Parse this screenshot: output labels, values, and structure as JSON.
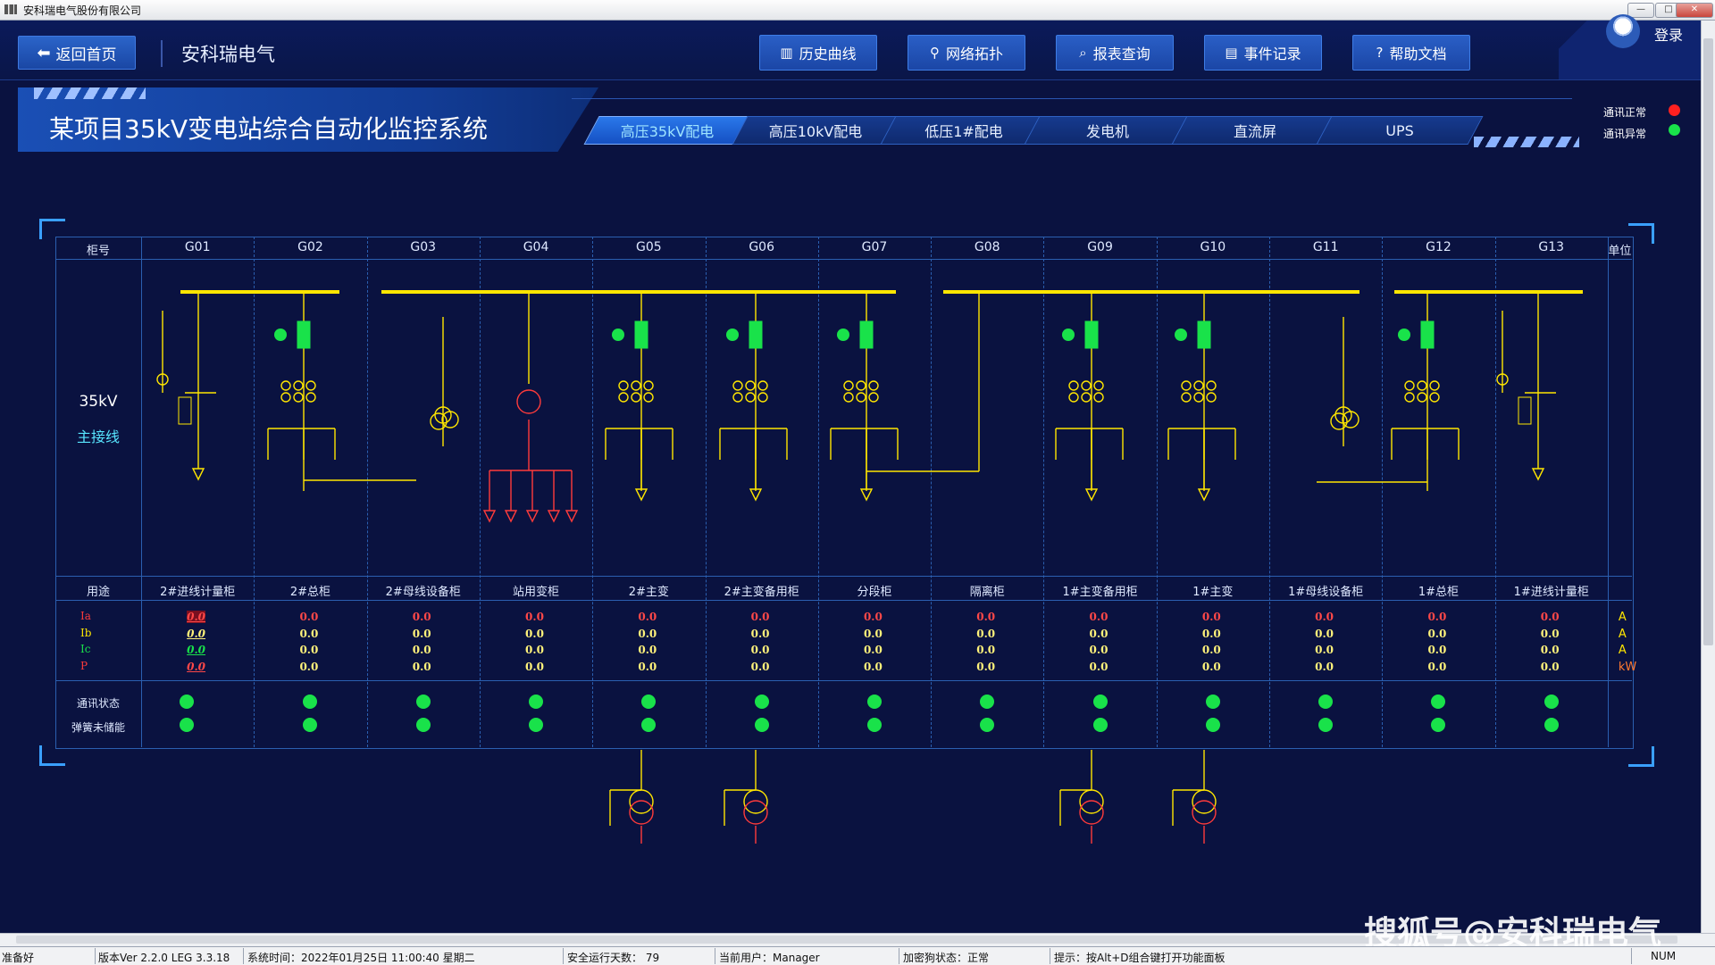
{
  "window": {
    "title": "安科瑞电气股份有限公司",
    "min": "—",
    "max": "□",
    "close": "✕"
  },
  "header": {
    "back_label": "返回首页",
    "brand": "安科瑞电气",
    "nav": [
      {
        "label": "历史曲线",
        "icon": "chart-icon"
      },
      {
        "label": "网络拓扑",
        "icon": "topology-icon"
      },
      {
        "label": "报表查询",
        "icon": "search-icon"
      },
      {
        "label": "事件记录",
        "icon": "document-icon"
      },
      {
        "label": "帮助文档",
        "icon": "help-icon"
      }
    ],
    "login_label": "登录"
  },
  "banner": {
    "title": "某项目35kV变电站综合自动化监控系统"
  },
  "tabs": [
    {
      "label": "高压35kV配电",
      "active": true
    },
    {
      "label": "高压10kV配电",
      "active": false
    },
    {
      "label": "低压1#配电",
      "active": false
    },
    {
      "label": "发电机",
      "active": false
    },
    {
      "label": "直流屏",
      "active": false
    },
    {
      "label": "UPS",
      "active": false
    }
  ],
  "comm_legend": [
    {
      "label": "通讯正常",
      "color": "#ff2020"
    },
    {
      "label": "通讯异常",
      "color": "#19e24a"
    }
  ],
  "table": {
    "header_left": "柜号",
    "header_right": "单位",
    "cabinets": [
      "G01",
      "G02",
      "G03",
      "G04",
      "G05",
      "G06",
      "G07",
      "G08",
      "G09",
      "G10",
      "G11",
      "G12",
      "G13"
    ],
    "bus_label_1": "35kV",
    "bus_label_2": "主接线",
    "usage_label": "用途",
    "usages": [
      "2#进线计量柜",
      "2#总柜",
      "2#母线设备柜",
      "站用变柜",
      "2#主变",
      "2#主变备用柜",
      "分段柜",
      "隔离柜",
      "1#主变备用柜",
      "1#主变",
      "1#母线设备柜",
      "1#总柜",
      "1#进线计量柜"
    ],
    "measure_labels": [
      {
        "name": "Ia",
        "color": "#ff3b3b"
      },
      {
        "name": "Ib",
        "color": "#ffe600"
      },
      {
        "name": "Ic",
        "color": "#19e24a"
      },
      {
        "name": "P",
        "color": "#ff3b3b"
      }
    ],
    "units": [
      "A",
      "A",
      "A",
      "kW"
    ],
    "measure_value": "0.0",
    "status_labels": [
      "通讯状态",
      "弹簧未储能"
    ]
  },
  "statusbar": {
    "ready": "准备好",
    "version": "版本Ver 2.2.0 LEG 3.3.18",
    "time": "系统时间：2022年01月25日  11:00:40   星期二",
    "safe_days": "安全运行天数：  79",
    "user": "当前用户：Manager",
    "dongle": "加密狗状态：正常",
    "hint": "提示：按Alt+D组合键打开功能面板",
    "num": "NUM"
  },
  "watermark": "搜狐号@安科瑞电气"
}
